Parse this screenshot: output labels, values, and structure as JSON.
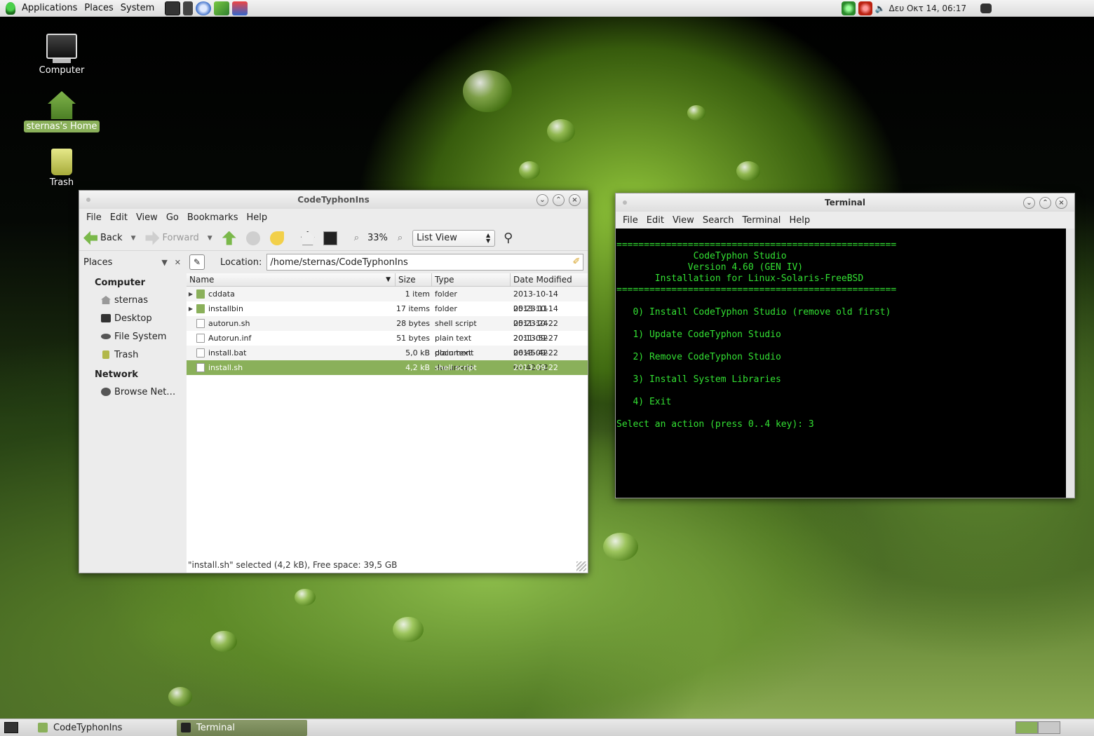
{
  "top_panel": {
    "menus": [
      "Applications",
      "Places",
      "System"
    ],
    "clock": "Δευ Οκτ 14, 06:17"
  },
  "desktop_icons": [
    {
      "label": "Computer"
    },
    {
      "label": "sternas's Home"
    },
    {
      "label": "Trash"
    }
  ],
  "file_manager": {
    "title": "CodeTyphonIns",
    "menu": [
      "File",
      "Edit",
      "View",
      "Go",
      "Bookmarks",
      "Help"
    ],
    "toolbar": {
      "back": "Back",
      "forward": "Forward",
      "zoom": "33%",
      "view_mode": "List View"
    },
    "places": {
      "header": "Places",
      "sections": [
        {
          "title": "Computer",
          "items": [
            "sternas",
            "Desktop",
            "File System",
            "Trash"
          ]
        },
        {
          "title": "Network",
          "items": [
            "Browse Net…"
          ]
        }
      ]
    },
    "location_label": "Location:",
    "location": "/home/sternas/CodeTyphonIns",
    "columns": [
      "Name",
      "Size",
      "Type",
      "Date Modified"
    ],
    "files": [
      {
        "name": "cddata",
        "size": "1 item",
        "type": "folder",
        "date": "2013-10-14 05:23:11",
        "kind": "folder"
      },
      {
        "name": "installbin",
        "size": "17 items",
        "type": "folder",
        "date": "2013-10-14 05:23:24",
        "kind": "folder"
      },
      {
        "name": "autorun.sh",
        "size": "28 bytes",
        "type": "shell script",
        "date": "2011-10-22 20:13:52",
        "kind": "doc"
      },
      {
        "name": "Autorun.inf",
        "size": "51 bytes",
        "type": "plain text document",
        "date": "2011-09-27 06:45:42",
        "kind": "doc"
      },
      {
        "name": "install.bat",
        "size": "5,0 kB",
        "type": "plain text document",
        "date": "2013-09-22 09:42:28",
        "kind": "doc"
      },
      {
        "name": "install.sh",
        "size": "4,2 kB",
        "type": "shell script",
        "date": "2013-09-22 09:42:34",
        "kind": "doc",
        "selected": true
      }
    ],
    "status": "\"install.sh\" selected (4,2 kB), Free space: 39,5 GB"
  },
  "terminal": {
    "title": "Terminal",
    "menu": [
      "File",
      "Edit",
      "View",
      "Search",
      "Terminal",
      "Help"
    ],
    "lines": [
      "===================================================",
      "              CodeTyphon Studio",
      "             Version 4.60 (GEN IV)",
      "       Installation for Linux-Solaris-FreeBSD",
      "===================================================",
      "",
      "   0) Install CodeTyphon Studio (remove old first)",
      "",
      "   1) Update CodeTyphon Studio",
      "",
      "   2) Remove CodeTyphon Studio",
      "",
      "   3) Install System Libraries",
      "",
      "   4) Exit",
      "",
      "Select an action (press 0..4 key): 3"
    ]
  },
  "taskbar": {
    "tasks": [
      {
        "label": "CodeTyphonIns",
        "active": false
      },
      {
        "label": "Terminal",
        "active": true
      }
    ]
  },
  "colors": {
    "accent": "#8ab05a",
    "terminal_text": "#33e033",
    "terminal_bg": "#000000"
  }
}
